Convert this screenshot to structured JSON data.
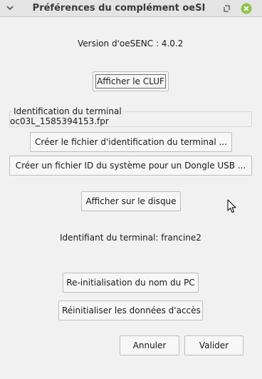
{
  "window": {
    "title": "Préférences du complément oeSI"
  },
  "content": {
    "version_label": "Version d'oeSENC : 4.0.2",
    "show_eula_label": "Afficher le CLUF",
    "terminal_id_group_title": "Identification du terminal",
    "terminal_id_value": "oc03L_1585394153.fpr",
    "create_terminal_id_file_label": "Créer le fichier d'identification du terminal ...",
    "create_dongle_id_file_label": "Créer un fichier ID du système pour un Dongle USB ...",
    "show_on_disk_label": "Afficher sur le disque",
    "terminal_identifier_text": "Identifiant du terminal: francine2",
    "reset_pc_name_label": "Re-initialisation du nom du PC",
    "reset_access_data_label": "Réinitialiser les données d'accès"
  },
  "footer": {
    "cancel_label": "Annuler",
    "ok_label": "Valider"
  },
  "icons": {
    "titlebar_left": "chevron-down-icon",
    "restore": "restore-icon",
    "close": "close-icon",
    "pointer": "mouse-pointer-icon"
  },
  "colors": {
    "close_button": "#8bc34a",
    "titlebar": "#e4e4e4",
    "window_bg": "#f1f1f1"
  }
}
